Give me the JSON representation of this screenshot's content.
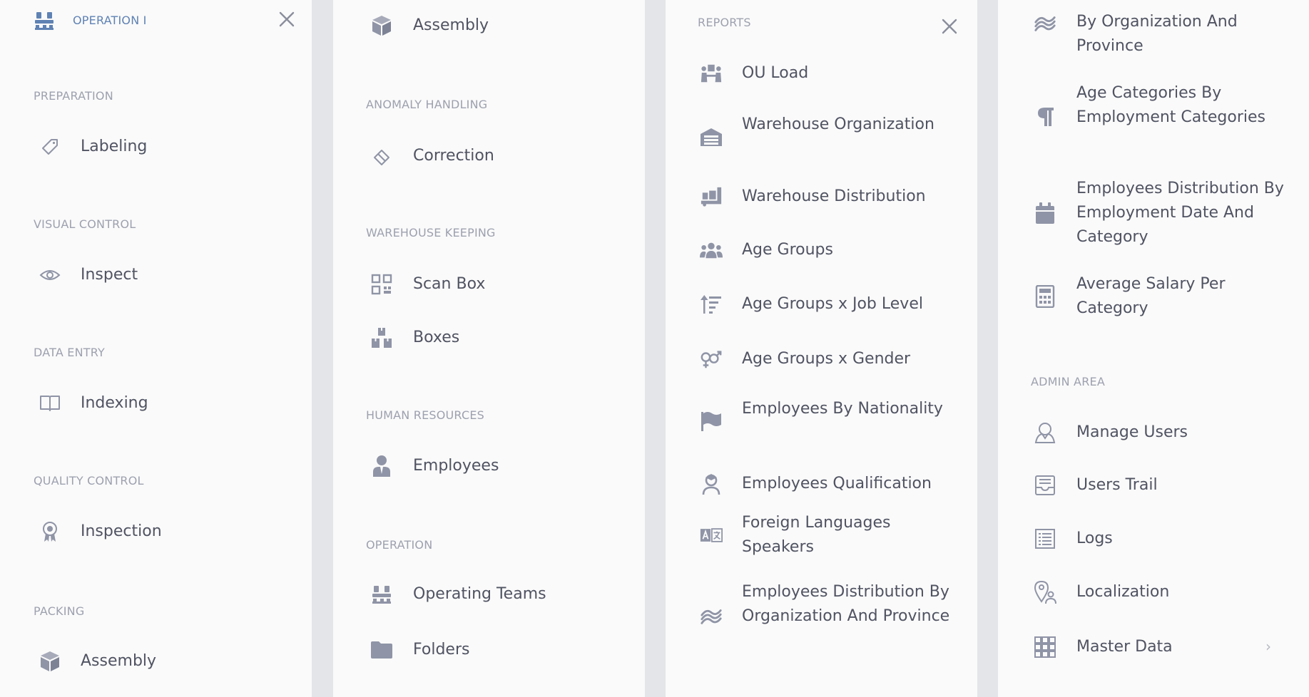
{
  "panel1": {
    "header": "OPERATION I",
    "sections": {
      "preparation": "PREPARATION",
      "visual_control": "VISUAL CONTROL",
      "data_entry": "DATA ENTRY",
      "quality_control": "QUALITY CONTROL",
      "packing": "PACKING"
    },
    "items": {
      "labeling": "Labeling",
      "inspect": "Inspect",
      "indexing": "Indexing",
      "inspection": "Inspection",
      "assembly": "Assembly"
    }
  },
  "panel2": {
    "sections": {
      "anomaly_handling": "ANOMALY HANDLING",
      "warehouse_keeping": "WAREHOUSE KEEPING",
      "human_resources": "HUMAN RESOURCES",
      "operation": "OPERATION"
    },
    "items": {
      "assembly": "Assembly",
      "correction": "Correction",
      "scan_box": "Scan Box",
      "boxes": "Boxes",
      "employees": "Employees",
      "operating_teams": "Operating Teams",
      "folders": "Folders"
    }
  },
  "panel3": {
    "header": "REPORTS",
    "items": {
      "ou_load": "OU Load",
      "warehouse_organization": "Warehouse Organization",
      "warehouse_distribution": "Warehouse Distribution",
      "age_groups": "Age Groups",
      "age_groups_job_level": "Age Groups x Job Level",
      "age_groups_gender": "Age Groups x Gender",
      "employees_by_nationality": "Employees By Nationality",
      "employees_qualification": "Employees Qualification",
      "foreign_languages_speakers": "Foreign Languages Speakers",
      "employees_distribution_org_province": "Employees Distribution By Organization And Province"
    }
  },
  "panel4": {
    "sections": {
      "admin_area": "ADMIN AREA"
    },
    "items": {
      "by_org_province": "By Organization And Province",
      "age_categories_employment": "Age Categories By Employment Categories",
      "employees_distribution_date_category": "Employees Distribution By Employment Date And Category",
      "average_salary_per_category": "Average Salary Per Category",
      "manage_users": "Manage Users",
      "users_trail": "Users Trail",
      "logs": "Logs",
      "localization": "Localization",
      "master_data": "Master Data"
    }
  },
  "colors": {
    "panel_bg": "#fafafa",
    "gap_bg": "#e3e5e8",
    "icon": "#8f94a6",
    "text": "#505362",
    "section": "#9da1af",
    "accent": "#5f82b4"
  },
  "icons": {
    "panel1_header": "pallet-icon",
    "labeling": "tag-icon",
    "inspect": "eye-icon",
    "indexing": "book-icon",
    "inspection": "award-icon",
    "assembly": "cube-icon",
    "correction": "eraser-icon",
    "scan_box": "qr-icon",
    "boxes": "boxes-icon",
    "employees": "employee-icon",
    "operating_teams": "pallet-icon",
    "folders": "folder-icon",
    "ou_load": "team-load-icon",
    "warehouse_organization": "warehouse-icon",
    "warehouse_distribution": "truck-loading-icon",
    "age_groups": "users-icon",
    "age_groups_job_level": "sort-amount-icon",
    "age_groups_gender": "gender-icon",
    "employees_by_nationality": "flag-icon",
    "employees_qualification": "user-graduate-icon",
    "foreign_languages_speakers": "language-icon",
    "employees_distribution": "stack-icon",
    "age_categories": "paragraph-icon",
    "employment_date": "calendar-icon",
    "average_salary": "calculator-icon",
    "manage_users": "user-outline-icon",
    "users_trail": "inbox-icon",
    "logs": "list-icon",
    "localization": "map-user-icon",
    "master_data": "grid-icon",
    "close": "close-icon",
    "chevron": "chevron-right-icon"
  }
}
